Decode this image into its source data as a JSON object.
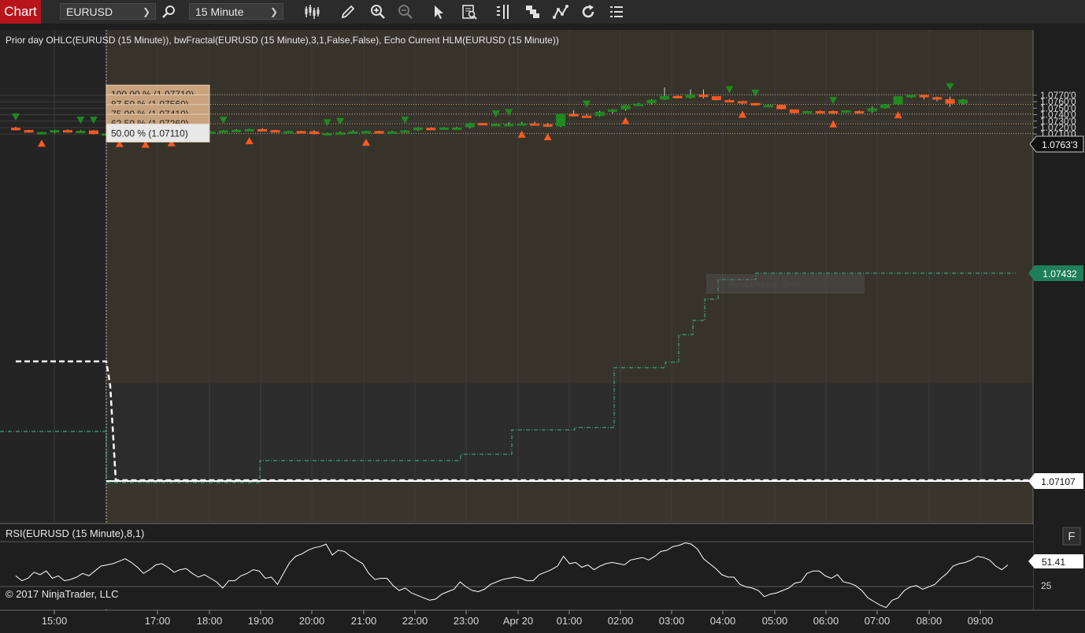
{
  "toolbar": {
    "tab_label": "Chart",
    "instrument": "EURUSD",
    "interval": "15 Minute"
  },
  "price_panel": {
    "indicators_label": "Prior day OHLC(EURUSD (15 Minute)), bwFractal(EURUSD (15 Minute),3,1,False,False), Echo Current HLM(EURUSD (15 Minute))",
    "levels": [
      {
        "label": "100.00 % (1.07710)",
        "price": 1.0771
      },
      {
        "label": "87.50 % (1.07560)",
        "price": 1.0756
      },
      {
        "label": "75.00 % (1.07410)",
        "price": 1.0741
      },
      {
        "label": "62.50 % (1.07260)",
        "price": 1.0726
      },
      {
        "label": "50.00 % (1.07110)",
        "price": 1.0711
      }
    ],
    "y_ticks": [
      {
        "label": "1.0770'0",
        "price": 1.077
      },
      {
        "label": "1.0760'0",
        "price": 1.076
      },
      {
        "label": "1.0750'0",
        "price": 1.075
      },
      {
        "label": "1.0740'0",
        "price": 1.074
      },
      {
        "label": "1.0730'0",
        "price": 1.073
      },
      {
        "label": "1.0720'0",
        "price": 1.072
      },
      {
        "label": "1.0710'0",
        "price": 1.071
      }
    ],
    "current_price_label": "1.0763'3",
    "current_price": 1.07633,
    "echo_label": "1.07432",
    "echo_price": 1.07432,
    "crosshair_label": "1.07107",
    "crosshair_price": 1.07107,
    "snip_text": "Rectangular Snip",
    "candles": [
      {
        "o": 1.07195,
        "h": 1.0721,
        "l": 1.07155,
        "c": 1.0716
      },
      {
        "o": 1.0716,
        "h": 1.07165,
        "l": 1.0712,
        "c": 1.07125
      },
      {
        "o": 1.07125,
        "h": 1.07135,
        "l": 1.0711,
        "c": 1.0713
      },
      {
        "o": 1.07125,
        "h": 1.07165,
        "l": 1.0711,
        "c": 1.0716
      },
      {
        "o": 1.0716,
        "h": 1.0717,
        "l": 1.0712,
        "c": 1.07135
      },
      {
        "o": 1.07135,
        "h": 1.0716,
        "l": 1.0712,
        "c": 1.0715
      },
      {
        "o": 1.07155,
        "h": 1.0716,
        "l": 1.07095,
        "c": 1.071
      },
      {
        "o": 1.071,
        "h": 1.07115,
        "l": 1.0708,
        "c": 1.0711
      },
      {
        "o": 1.07115,
        "h": 1.0712,
        "l": 1.07105,
        "c": 1.0711
      },
      {
        "o": 1.07115,
        "h": 1.0712,
        "l": 1.07095,
        "c": 1.071
      },
      {
        "o": 1.071,
        "h": 1.0712,
        "l": 1.07095,
        "c": 1.0711
      },
      {
        "o": 1.07115,
        "h": 1.0715,
        "l": 1.07105,
        "c": 1.0714
      },
      {
        "o": 1.07145,
        "h": 1.07155,
        "l": 1.07115,
        "c": 1.07125
      },
      {
        "o": 1.0713,
        "h": 1.0714,
        "l": 1.07115,
        "c": 1.07125
      },
      {
        "o": 1.07125,
        "h": 1.0713,
        "l": 1.07115,
        "c": 1.0712
      },
      {
        "o": 1.0712,
        "h": 1.07145,
        "l": 1.0711,
        "c": 1.0714
      },
      {
        "o": 1.0714,
        "h": 1.0716,
        "l": 1.0713,
        "c": 1.07155
      },
      {
        "o": 1.07155,
        "h": 1.07175,
        "l": 1.0714,
        "c": 1.07165
      },
      {
        "o": 1.07165,
        "h": 1.0718,
        "l": 1.0715,
        "c": 1.07175
      },
      {
        "o": 1.07175,
        "h": 1.0719,
        "l": 1.0715,
        "c": 1.0716
      },
      {
        "o": 1.0716,
        "h": 1.0716,
        "l": 1.0713,
        "c": 1.07135
      },
      {
        "o": 1.07135,
        "h": 1.0715,
        "l": 1.0712,
        "c": 1.07145
      },
      {
        "o": 1.07145,
        "h": 1.0715,
        "l": 1.0713,
        "c": 1.0714
      },
      {
        "o": 1.0714,
        "h": 1.0716,
        "l": 1.07095,
        "c": 1.071
      },
      {
        "o": 1.071,
        "h": 1.0712,
        "l": 1.0709,
        "c": 1.07115
      },
      {
        "o": 1.07115,
        "h": 1.0714,
        "l": 1.07105,
        "c": 1.07125
      },
      {
        "o": 1.0712,
        "h": 1.07155,
        "l": 1.0711,
        "c": 1.0714
      },
      {
        "o": 1.0714,
        "h": 1.0715,
        "l": 1.07125,
        "c": 1.07145
      },
      {
        "o": 1.07145,
        "h": 1.0715,
        "l": 1.07125,
        "c": 1.0713
      },
      {
        "o": 1.0713,
        "h": 1.0715,
        "l": 1.0712,
        "c": 1.0714
      },
      {
        "o": 1.0714,
        "h": 1.0716,
        "l": 1.0713,
        "c": 1.07155
      },
      {
        "o": 1.0716,
        "h": 1.07205,
        "l": 1.0715,
        "c": 1.072
      },
      {
        "o": 1.07195,
        "h": 1.07205,
        "l": 1.07175,
        "c": 1.0718
      },
      {
        "o": 1.0718,
        "h": 1.07205,
        "l": 1.07175,
        "c": 1.072
      },
      {
        "o": 1.072,
        "h": 1.0721,
        "l": 1.0719,
        "c": 1.072
      },
      {
        "o": 1.07205,
        "h": 1.07275,
        "l": 1.0719,
        "c": 1.0727
      },
      {
        "o": 1.0727,
        "h": 1.0727,
        "l": 1.0724,
        "c": 1.07255
      },
      {
        "o": 1.07255,
        "h": 1.0726,
        "l": 1.0725,
        "c": 1.07255
      },
      {
        "o": 1.07255,
        "h": 1.0728,
        "l": 1.0724,
        "c": 1.07255
      },
      {
        "o": 1.07255,
        "h": 1.07285,
        "l": 1.0725,
        "c": 1.07265
      },
      {
        "o": 1.07265,
        "h": 1.0729,
        "l": 1.0724,
        "c": 1.0725
      },
      {
        "o": 1.0725,
        "h": 1.0727,
        "l": 1.0721,
        "c": 1.0722
      },
      {
        "o": 1.0722,
        "h": 1.0741,
        "l": 1.0721,
        "c": 1.0741
      },
      {
        "o": 1.0741,
        "h": 1.0747,
        "l": 1.0737,
        "c": 1.07385
      },
      {
        "o": 1.07385,
        "h": 1.0741,
        "l": 1.07365,
        "c": 1.0738
      },
      {
        "o": 1.0738,
        "h": 1.0746,
        "l": 1.0737,
        "c": 1.07445
      },
      {
        "o": 1.07445,
        "h": 1.07485,
        "l": 1.0742,
        "c": 1.0748
      },
      {
        "o": 1.0748,
        "h": 1.0755,
        "l": 1.0746,
        "c": 1.07545
      },
      {
        "o": 1.0755,
        "h": 1.0758,
        "l": 1.0754,
        "c": 1.0757
      },
      {
        "o": 1.07575,
        "h": 1.0764,
        "l": 1.0756,
        "c": 1.0763
      },
      {
        "o": 1.07635,
        "h": 1.0782,
        "l": 1.0763,
        "c": 1.0769
      },
      {
        "o": 1.0769,
        "h": 1.07695,
        "l": 1.07655,
        "c": 1.07655
      },
      {
        "o": 1.0766,
        "h": 1.0779,
        "l": 1.0765,
        "c": 1.0771
      },
      {
        "o": 1.0771,
        "h": 1.0779,
        "l": 1.0765,
        "c": 1.07685
      },
      {
        "o": 1.07685,
        "h": 1.0768,
        "l": 1.0762,
        "c": 1.07625
      },
      {
        "o": 1.07625,
        "h": 1.07635,
        "l": 1.0759,
        "c": 1.0761
      },
      {
        "o": 1.0761,
        "h": 1.07605,
        "l": 1.0756,
        "c": 1.0758
      },
      {
        "o": 1.0758,
        "h": 1.0758,
        "l": 1.0754,
        "c": 1.07545
      },
      {
        "o": 1.0755,
        "h": 1.07555,
        "l": 1.0754,
        "c": 1.0755
      },
      {
        "o": 1.0755,
        "h": 1.07555,
        "l": 1.0748,
        "c": 1.07485
      },
      {
        "o": 1.0748,
        "h": 1.0748,
        "l": 1.0742,
        "c": 1.07425
      },
      {
        "o": 1.07425,
        "h": 1.0746,
        "l": 1.0742,
        "c": 1.07455
      },
      {
        "o": 1.07455,
        "h": 1.07465,
        "l": 1.0744,
        "c": 1.07445
      },
      {
        "o": 1.07455,
        "h": 1.07465,
        "l": 1.0741,
        "c": 1.07445
      },
      {
        "o": 1.07445,
        "h": 1.07465,
        "l": 1.0743,
        "c": 1.07465
      },
      {
        "o": 1.07455,
        "h": 1.07465,
        "l": 1.0744,
        "c": 1.07445
      },
      {
        "o": 1.0745,
        "h": 1.07525,
        "l": 1.0743,
        "c": 1.075
      },
      {
        "o": 1.075,
        "h": 1.07565,
        "l": 1.07495,
        "c": 1.0756
      },
      {
        "o": 1.0756,
        "h": 1.0766,
        "l": 1.0755,
        "c": 1.07685
      },
      {
        "o": 1.07685,
        "h": 1.07695,
        "l": 1.0766,
        "c": 1.07705
      },
      {
        "o": 1.07705,
        "h": 1.0769,
        "l": 1.07635,
        "c": 1.0767
      },
      {
        "o": 1.0767,
        "h": 1.0768,
        "l": 1.0761,
        "c": 1.0764
      },
      {
        "o": 1.0764,
        "h": 1.0768,
        "l": 1.0752,
        "c": 1.0757
      },
      {
        "o": 1.0757,
        "h": 1.0764,
        "l": 1.0756,
        "c": 1.07633
      }
    ],
    "fractals_up": [
      0,
      5,
      6,
      10,
      11,
      16,
      24,
      25,
      30,
      37,
      38,
      44,
      55,
      57,
      63,
      72
    ],
    "fractals_down": [
      2,
      8,
      10,
      12,
      18,
      27,
      39,
      41,
      47,
      56,
      63,
      68
    ]
  },
  "rsi_panel": {
    "label": "RSI(EURUSD (15 Minute),8,1)",
    "current_label": "51.41",
    "current_value": 51.41,
    "ref_tick_label": "25",
    "f_button": "F",
    "values": [
      42,
      38,
      40,
      45,
      43,
      46,
      40,
      42,
      38,
      39,
      41,
      44,
      42,
      46,
      50,
      51,
      52,
      54,
      56,
      53,
      49,
      44,
      47,
      51,
      52,
      49,
      45,
      47,
      48,
      44,
      41,
      43,
      40,
      37,
      32,
      38,
      38,
      42,
      44,
      47,
      46,
      40,
      41,
      35,
      44,
      53,
      58,
      60,
      63,
      65,
      66,
      68,
      59,
      63,
      62,
      58,
      55,
      52,
      44,
      39,
      40,
      40,
      34,
      30,
      32,
      28,
      26,
      24,
      22,
      23,
      27,
      29,
      31,
      37,
      33,
      30,
      29,
      31,
      35,
      37,
      39,
      40,
      41,
      40,
      38,
      38,
      43,
      45,
      47,
      50,
      58,
      52,
      53,
      49,
      51,
      47,
      50,
      52,
      53,
      52,
      51,
      55,
      56,
      57,
      55,
      58,
      62,
      63,
      66,
      67,
      69,
      68,
      64,
      56,
      52,
      48,
      43,
      41,
      41,
      35,
      33,
      32,
      30,
      25,
      27,
      28,
      30,
      32,
      36,
      37,
      44,
      46,
      46,
      42,
      40,
      43,
      37,
      36,
      34,
      30,
      24,
      21,
      18,
      16,
      22,
      24,
      30,
      33,
      34,
      31,
      33,
      35,
      40,
      44,
      50,
      52,
      53,
      55,
      58,
      57,
      55,
      50,
      47,
      51
    ]
  },
  "x_axis": {
    "labels": [
      "15:00",
      "17:00",
      "18:00",
      "19:00",
      "20:00",
      "21:00",
      "22:00",
      "23:00",
      "Apr 20",
      "01:00",
      "02:00",
      "03:00",
      "04:00",
      "05:00",
      "06:00",
      "07:00",
      "08:00",
      "09:00"
    ]
  },
  "copyright": "© 2017 NinjaTrader, LLC",
  "colors": {
    "up": "#1f8a1f",
    "down": "#ff5a1f",
    "fractal_up": "#1f8a1f",
    "fractal_down": "#ff5a1f",
    "echo": "#3aa07a",
    "level_label_bg": "#c9a37e"
  }
}
